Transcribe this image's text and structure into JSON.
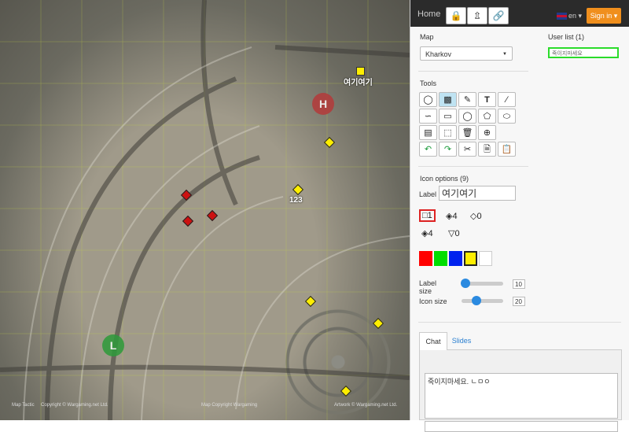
{
  "map": {
    "markers": [
      {
        "label": "여기여기"
      },
      {
        "label": "123"
      }
    ],
    "circle_label": "H",
    "circle2_label": "L",
    "captions": [
      "Map Tactic",
      "Copyright © Wargaming.net Ltd.",
      "Map Copyright Wargaming",
      "Artwork © Wargaming.net Ltd."
    ],
    "colors": {
      "marker_yellow": "#ffee00",
      "red_zone": "#c03838",
      "green_zone": "#2e9a3a",
      "diamond_red": "#cc1111"
    }
  },
  "navbar": {
    "home": "Home",
    "lock_icon": "lock-icon",
    "upload_icon": "upload-icon",
    "link_icon": "link-icon",
    "lang": "en",
    "signin": "Sign in"
  },
  "panel": {
    "map_label": "Map",
    "map_value": "Kharkov",
    "userlist_label": "User list (1)",
    "user_name": "죽이지마세요",
    "tools_label": "Tools",
    "icon_options_label": "Icon options (9)",
    "label_text": "Label",
    "label_value": "여기여기",
    "icon_counts": [
      "1",
      "4",
      "0",
      "4",
      "0"
    ],
    "colors": [
      "#ff0000",
      "#00dd00",
      "#0022ee",
      "#ffee00",
      "#ffffff"
    ],
    "label_size_label": "Label size",
    "label_size_value": "10",
    "label_size_fraction": 0.1,
    "icon_size_label": "Icon size",
    "icon_size_value": "20",
    "icon_size_fraction": 0.35,
    "chat_tab": "Chat",
    "slides_tab": "Slides",
    "chat_text": "죽이지마세요. ㄴㅁㅇ"
  }
}
